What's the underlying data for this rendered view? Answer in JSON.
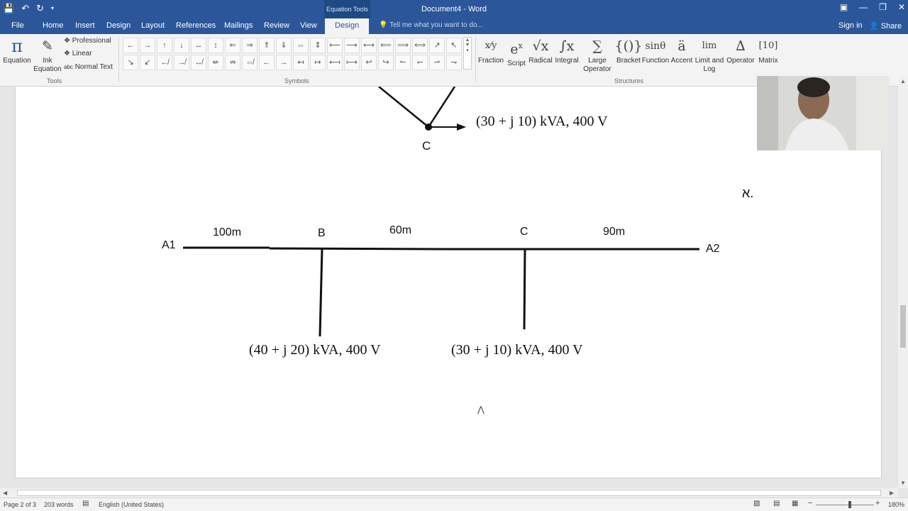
{
  "titlebar": {
    "context_tab": "Equation Tools",
    "doc_title": "Document4 - Word"
  },
  "tabs": {
    "file": "File",
    "home": "Home",
    "insert": "Insert",
    "design": "Design",
    "layout": "Layout",
    "references": "References",
    "mailings": "Mailings",
    "review": "Review",
    "view": "View",
    "eq_design": "Design",
    "tell_me": "Tell me what you want to do...",
    "sign_in": "Sign in",
    "share": "Share"
  },
  "ribbon": {
    "tools": {
      "equation": "Equation",
      "ink_equation_1": "Ink",
      "ink_equation_2": "Equation",
      "professional": "Professional",
      "linear": "Linear",
      "normal_text": "Normal Text",
      "group_label": "Tools"
    },
    "symbols": {
      "group_label": "Symbols",
      "row1": [
        "←",
        "→",
        "↑",
        "↓",
        "↔",
        "↕",
        "⇐",
        "⇒",
        "⇑",
        "⇓",
        "⇔",
        "⇕",
        "⟵",
        "⟶",
        "⟷",
        "⟸",
        "⟹",
        "⟺",
        "↗",
        "↖"
      ],
      "row2": [
        "↘",
        "↙",
        "↚",
        "↛",
        "↮",
        "⇍",
        "⇏",
        "⇎",
        "←",
        "→",
        "↤",
        "↦",
        "⟻",
        "⟼",
        "↩",
        "↪",
        "↼",
        "↽",
        "⇀",
        "⇁"
      ]
    },
    "structures": {
      "group_label": "Structures",
      "fraction": "Fraction",
      "script": "Script",
      "radical": "Radical",
      "integral": "Integral",
      "large_operator_1": "Large",
      "large_operator_2": "Operator",
      "bracket": "Bracket",
      "function": "Function",
      "accent": "Accent",
      "limit_1": "Limit and",
      "limit_2": "Log",
      "operator": "Operator",
      "matrix": "Matrix"
    }
  },
  "document": {
    "top_node": "C",
    "top_load": "(30 + j 10) kVA, 400 V",
    "hebrew_marker": "א.",
    "node_a1": "A1",
    "node_a2": "A2",
    "node_b": "B",
    "node_c": "C",
    "seg_a1_b": "100m",
    "seg_b_c": "60m",
    "seg_c_a2": "90m",
    "load_b": "(40 + j 20) kVA, 400 V",
    "load_c": "(30 + j 10) kVA, 400 V"
  },
  "statusbar": {
    "page": "Page 2 of 3",
    "words": "203 words",
    "language": "English (United States)",
    "zoom": "180%"
  }
}
